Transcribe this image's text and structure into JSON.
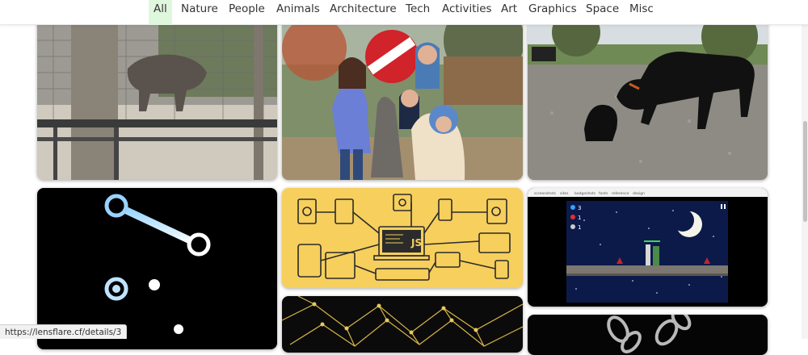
{
  "nav": {
    "items": [
      {
        "label": "All",
        "active": true
      },
      {
        "label": "Nature"
      },
      {
        "label": "People"
      },
      {
        "label": "Animals"
      },
      {
        "label": "Architecture"
      },
      {
        "label": "Tech"
      },
      {
        "label": "Activities"
      },
      {
        "label": "Art"
      },
      {
        "label": "Graphics"
      },
      {
        "label": "Space"
      },
      {
        "label": "Misc"
      }
    ],
    "active_color": "#dff7dd"
  },
  "gallery": {
    "game_tabs": [
      "screenshots",
      "sites",
      "badgeshots",
      "fonts",
      "reference",
      "design"
    ],
    "game_hud": [
      "3",
      "1",
      "1"
    ],
    "js_label": "JS"
  },
  "status_bar": {
    "url": "https://lensflare.cf/details/3"
  }
}
